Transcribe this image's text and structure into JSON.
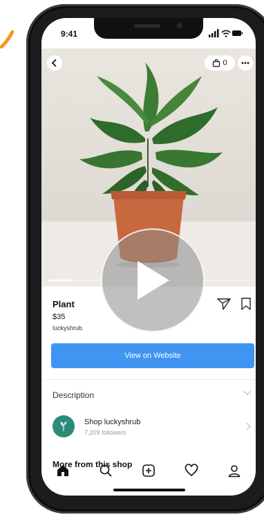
{
  "status_bar": {
    "time": "9:41"
  },
  "header": {
    "bag_count": "0"
  },
  "product": {
    "name": "Plant",
    "price": "$35",
    "seller": "luckyshrub"
  },
  "actions": {
    "view_website_label": "View on Website"
  },
  "video": {
    "progress": 0.12
  },
  "sections": {
    "description_label": "Description",
    "more_label": "More from this shop"
  },
  "shop": {
    "name": "Shop luckyshrub",
    "followers": "7,209 followers"
  },
  "tabbar": {
    "items": [
      "home-icon",
      "search-icon",
      "create-icon",
      "heart-icon",
      "profile-icon"
    ]
  },
  "colors": {
    "accent": "#3f95f1",
    "shop_avatar": "#2a8c78",
    "pot": "#c8683f",
    "marker": "#f29a1e"
  }
}
